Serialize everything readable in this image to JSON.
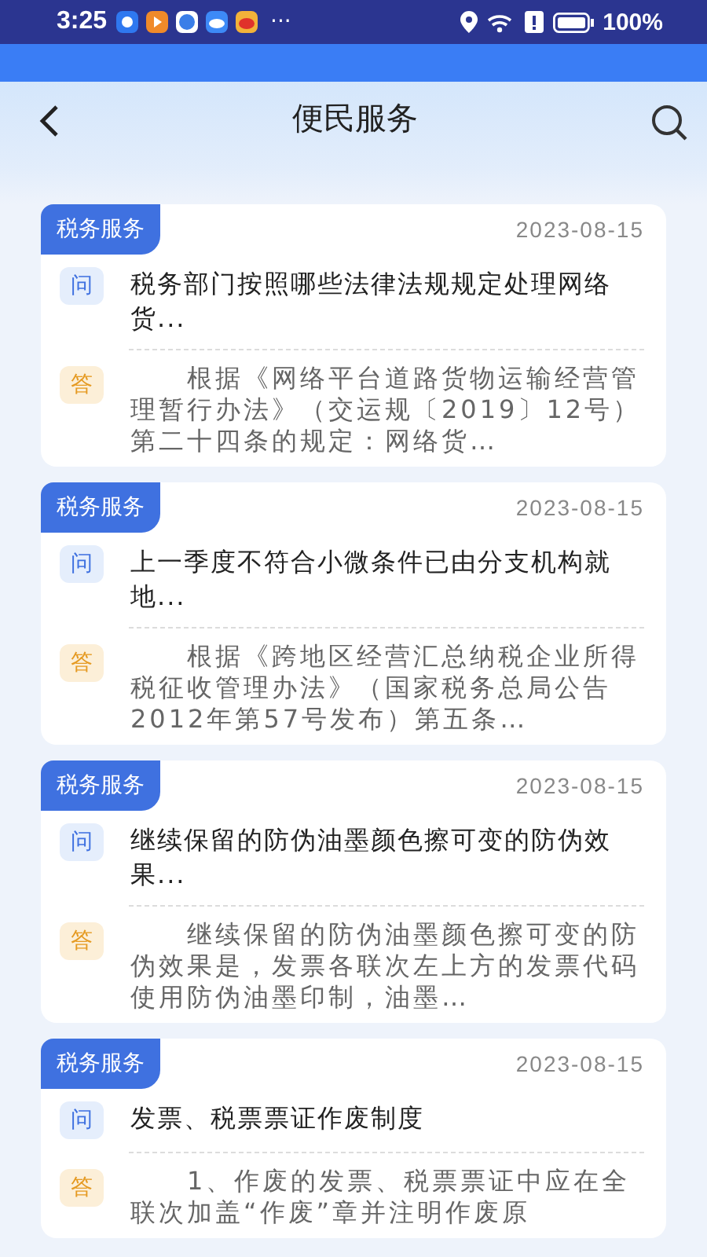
{
  "status_bar": {
    "time": "3:25",
    "more": "···",
    "battery": "100%"
  },
  "header": {
    "title": "便民服务"
  },
  "cards": [
    {
      "tag": "税务服务",
      "date": "2023-08-15",
      "q_label": "问",
      "question": "税务部门按照哪些法律法规规定处理网络货...",
      "a_label": "答",
      "answer": "根据《网络平台道路货物运输经营管理暂行办法》（交运规〔2019〕12号）第二十四条的规定：网络货…"
    },
    {
      "tag": "税务服务",
      "date": "2023-08-15",
      "q_label": "问",
      "question": "上一季度不符合小微条件已由分支机构就地...",
      "a_label": "答",
      "answer": "根据《跨地区经营汇总纳税企业所得税征收管理办法》（国家税务总局公告2012年第57号发布）第五条…"
    },
    {
      "tag": "税务服务",
      "date": "2023-08-15",
      "q_label": "问",
      "question": "继续保留的防伪油墨颜色擦可变的防伪效果...",
      "a_label": "答",
      "answer": "继续保留的防伪油墨颜色擦可变的防伪效果是，发票各联次左上方的发票代码使用防伪油墨印制，油墨…"
    },
    {
      "tag": "税务服务",
      "date": "2023-08-15",
      "q_label": "问",
      "question": "发票、税票票证作废制度",
      "a_label": "答",
      "answer": "1、作废的发票、税票票证中应在全联次加盖“作废”章并注明作废原"
    }
  ]
}
